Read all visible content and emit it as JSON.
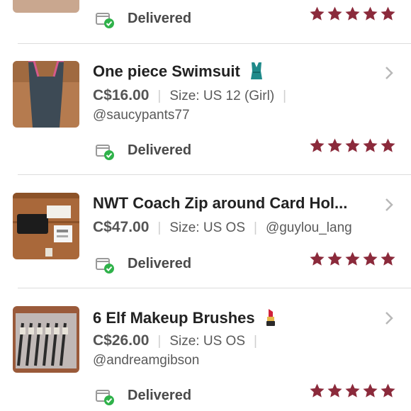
{
  "items": [
    {
      "title": "One piece Swimsuit",
      "price": "C$16.00",
      "size": "Size: US 12 (Girl)",
      "seller": "@saucypants77",
      "status": "Delivered",
      "rating": 5,
      "emoji": "swimsuit-icon"
    },
    {
      "title": "NWT Coach Zip around Card Hol...",
      "price": "C$47.00",
      "size": "Size: US OS",
      "seller": "@guylou_lang",
      "status": "Delivered",
      "rating": 5
    },
    {
      "title": "6 Elf Makeup Brushes",
      "price": "C$26.00",
      "size": "Size: US OS",
      "seller": "@andreamgibson",
      "status": "Delivered",
      "rating": 5,
      "emoji": "lipstick-icon"
    }
  ],
  "top_row": {
    "status": "Delivered",
    "rating": 5
  },
  "colors": {
    "star": "#8b2a3b",
    "check": "#2fb24a"
  }
}
